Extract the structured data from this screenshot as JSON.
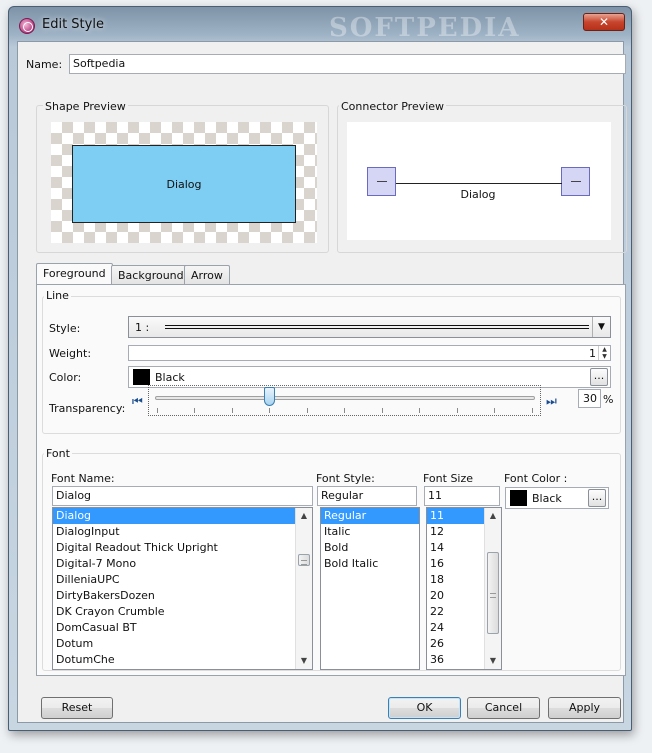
{
  "window": {
    "title": "Edit Style",
    "watermark": "SOFTPEDIA",
    "close_glyph": "✕"
  },
  "name": {
    "label": "Name:",
    "value": "Softpedia"
  },
  "previews": {
    "shape_title": "Shape Preview",
    "shape_label": "Dialog",
    "shape_fill": "#7ecef4",
    "connector_title": "Connector Preview",
    "connector_label": "Dialog"
  },
  "tabs": [
    {
      "label": "Foreground"
    },
    {
      "label": "Background"
    },
    {
      "label": "Arrow"
    }
  ],
  "line": {
    "title": "Line",
    "style_label": "Style:",
    "style_value": "1 :",
    "style_arrow": "▼",
    "weight_label": "Weight:",
    "weight_value": "1",
    "color_label": "Color:",
    "color_value": "Black",
    "color_button": "...",
    "transparency_label": "Transparency:",
    "transparency_value": "30",
    "transparency_unit": "%",
    "transparency_level": 0.3,
    "first_glyph": "⏮",
    "last_glyph": "⏭"
  },
  "font": {
    "title": "Font",
    "name_label": "Font Name:",
    "name_value": "Dialog",
    "names": [
      "Dialog",
      "DialogInput",
      "Digital Readout Thick Upright",
      "Digital-7 Mono",
      "DilleniaUPC",
      "DirtyBakersDozen",
      "DK Crayon Crumble",
      "DomCasual BT",
      "Dotum",
      "DotumChe"
    ],
    "style_label": "Font Style:",
    "style_value": "Regular",
    "styles": [
      "Regular",
      "Italic",
      "Bold",
      "Bold Italic"
    ],
    "size_label": "Font Size",
    "size_value": "11",
    "sizes": [
      "11",
      "12",
      "14",
      "16",
      "18",
      "20",
      "22",
      "24",
      "26",
      "36"
    ],
    "color_label": "Font Color :",
    "color_value": "Black",
    "color_button": "..."
  },
  "buttons": {
    "reset": "Reset",
    "ok": "OK",
    "cancel": "Cancel",
    "apply": "Apply"
  }
}
